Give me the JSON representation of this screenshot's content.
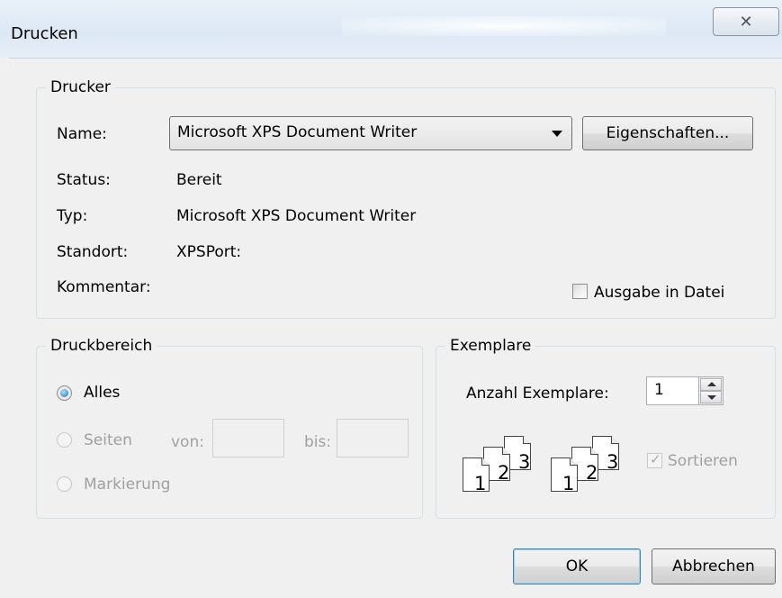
{
  "window": {
    "title": "Drucken",
    "close_glyph": "✕"
  },
  "printer": {
    "legend": "Drucker",
    "name_label": "Name:",
    "selected_printer": "Microsoft XPS Document Writer",
    "properties_button": "Eigenschaften...",
    "status_label": "Status:",
    "status_value": "Bereit",
    "type_label": "Typ:",
    "type_value": "Microsoft XPS Document Writer",
    "location_label": "Standort:",
    "location_value": "XPSPort:",
    "comment_label": "Kommentar:",
    "print_to_file_label": "Ausgabe in Datei"
  },
  "range": {
    "legend": "Druckbereich",
    "all_label": "Alles",
    "pages_label": "Seiten",
    "from_label": "von:",
    "to_label": "bis:",
    "selection_label": "Markierung"
  },
  "copies": {
    "legend": "Exemplare",
    "count_label": "Anzahl Exemplare:",
    "count_value": "1",
    "collate_label": "Sortieren",
    "stack1": [
      "1",
      "2",
      "3"
    ],
    "stack2": [
      "1",
      "2",
      "3"
    ]
  },
  "buttons": {
    "ok": "OK",
    "cancel": "Abbrechen"
  }
}
